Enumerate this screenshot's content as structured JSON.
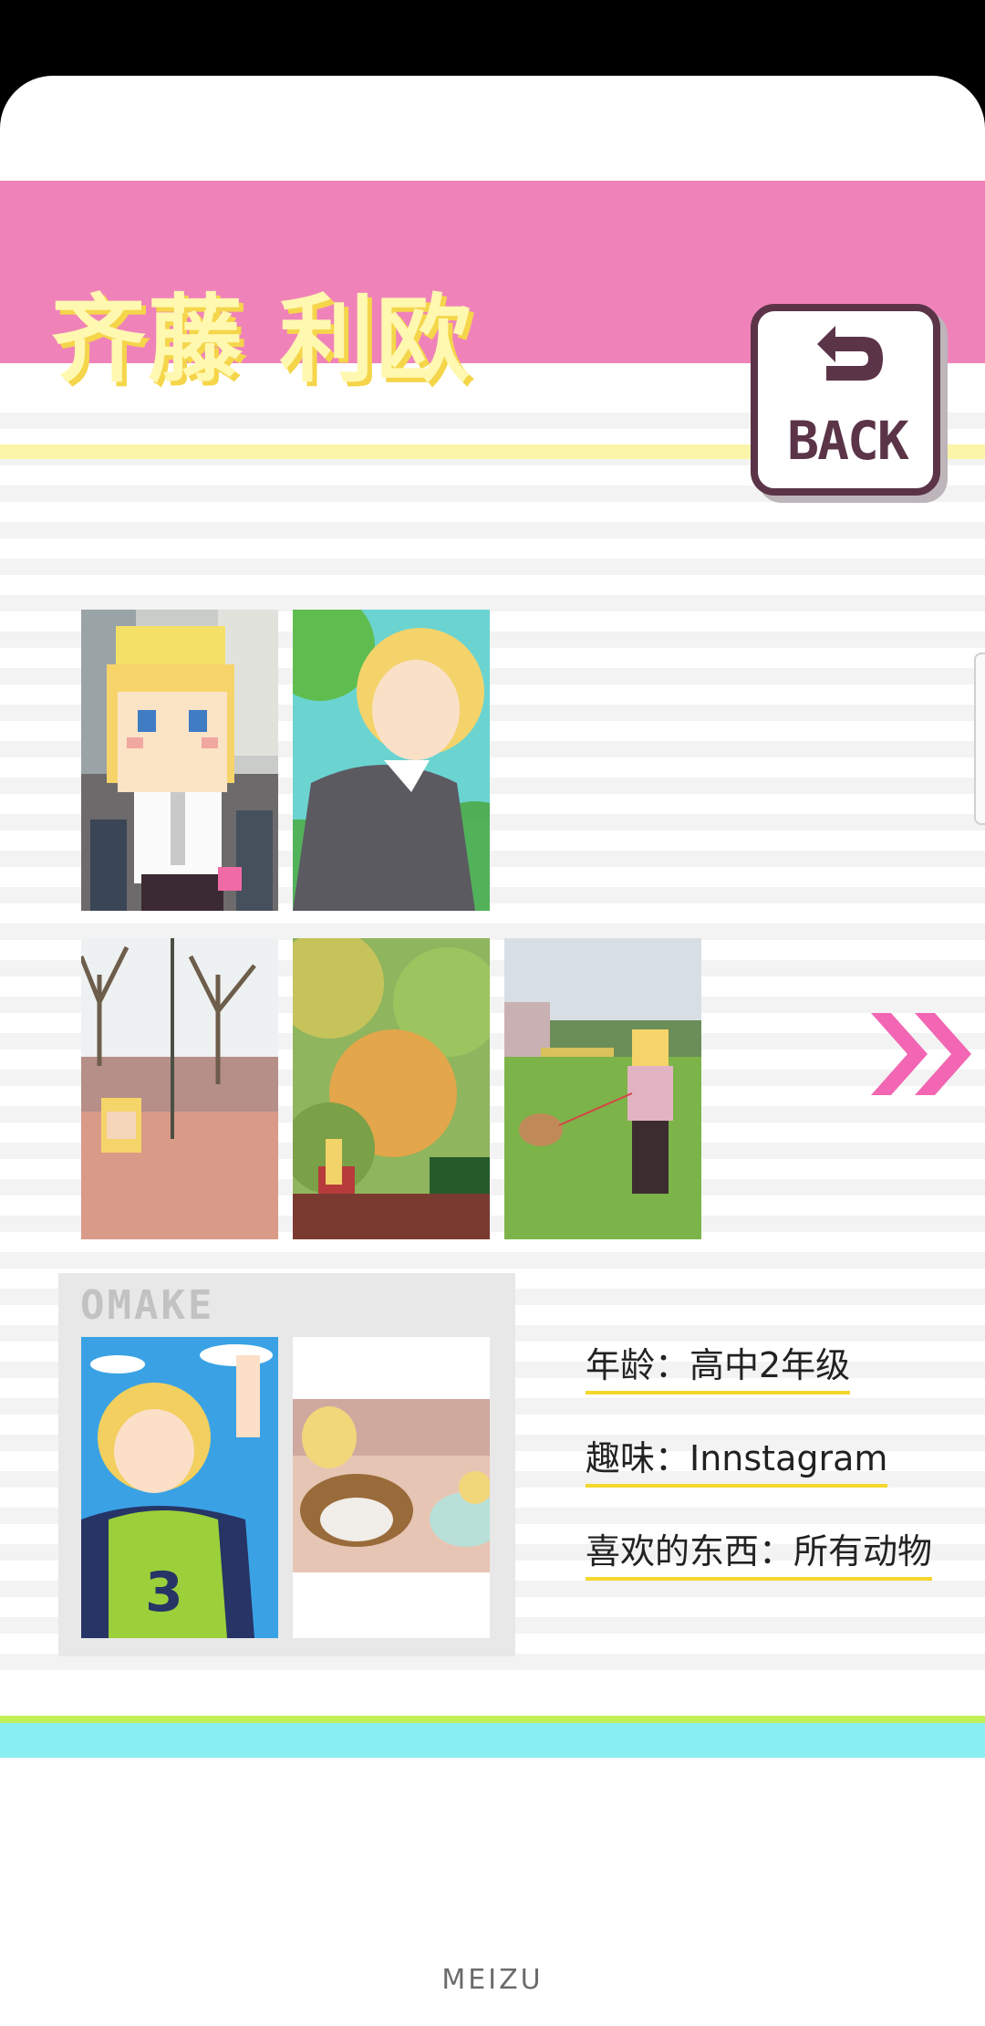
{
  "header": {
    "title": "齐藤 利欧",
    "back_label": "BACK"
  },
  "omake": {
    "label": "OMAKE"
  },
  "info": [
    {
      "label": "年龄：高中2年级"
    },
    {
      "label": "趣味：Innstagram"
    },
    {
      "label": "喜欢的东西：所有动物"
    }
  ],
  "device": {
    "brand": "MEIZU"
  },
  "colors": {
    "header": "#ef83b9",
    "title": "#fff8b0",
    "title_shadow": "#f5d54a",
    "back_border": "#5b3448",
    "next_arrow": "#f266b3",
    "info_underline": "#f5d62c",
    "bottom_green": "#c3ef57",
    "bottom_cyan": "#88eef2"
  }
}
